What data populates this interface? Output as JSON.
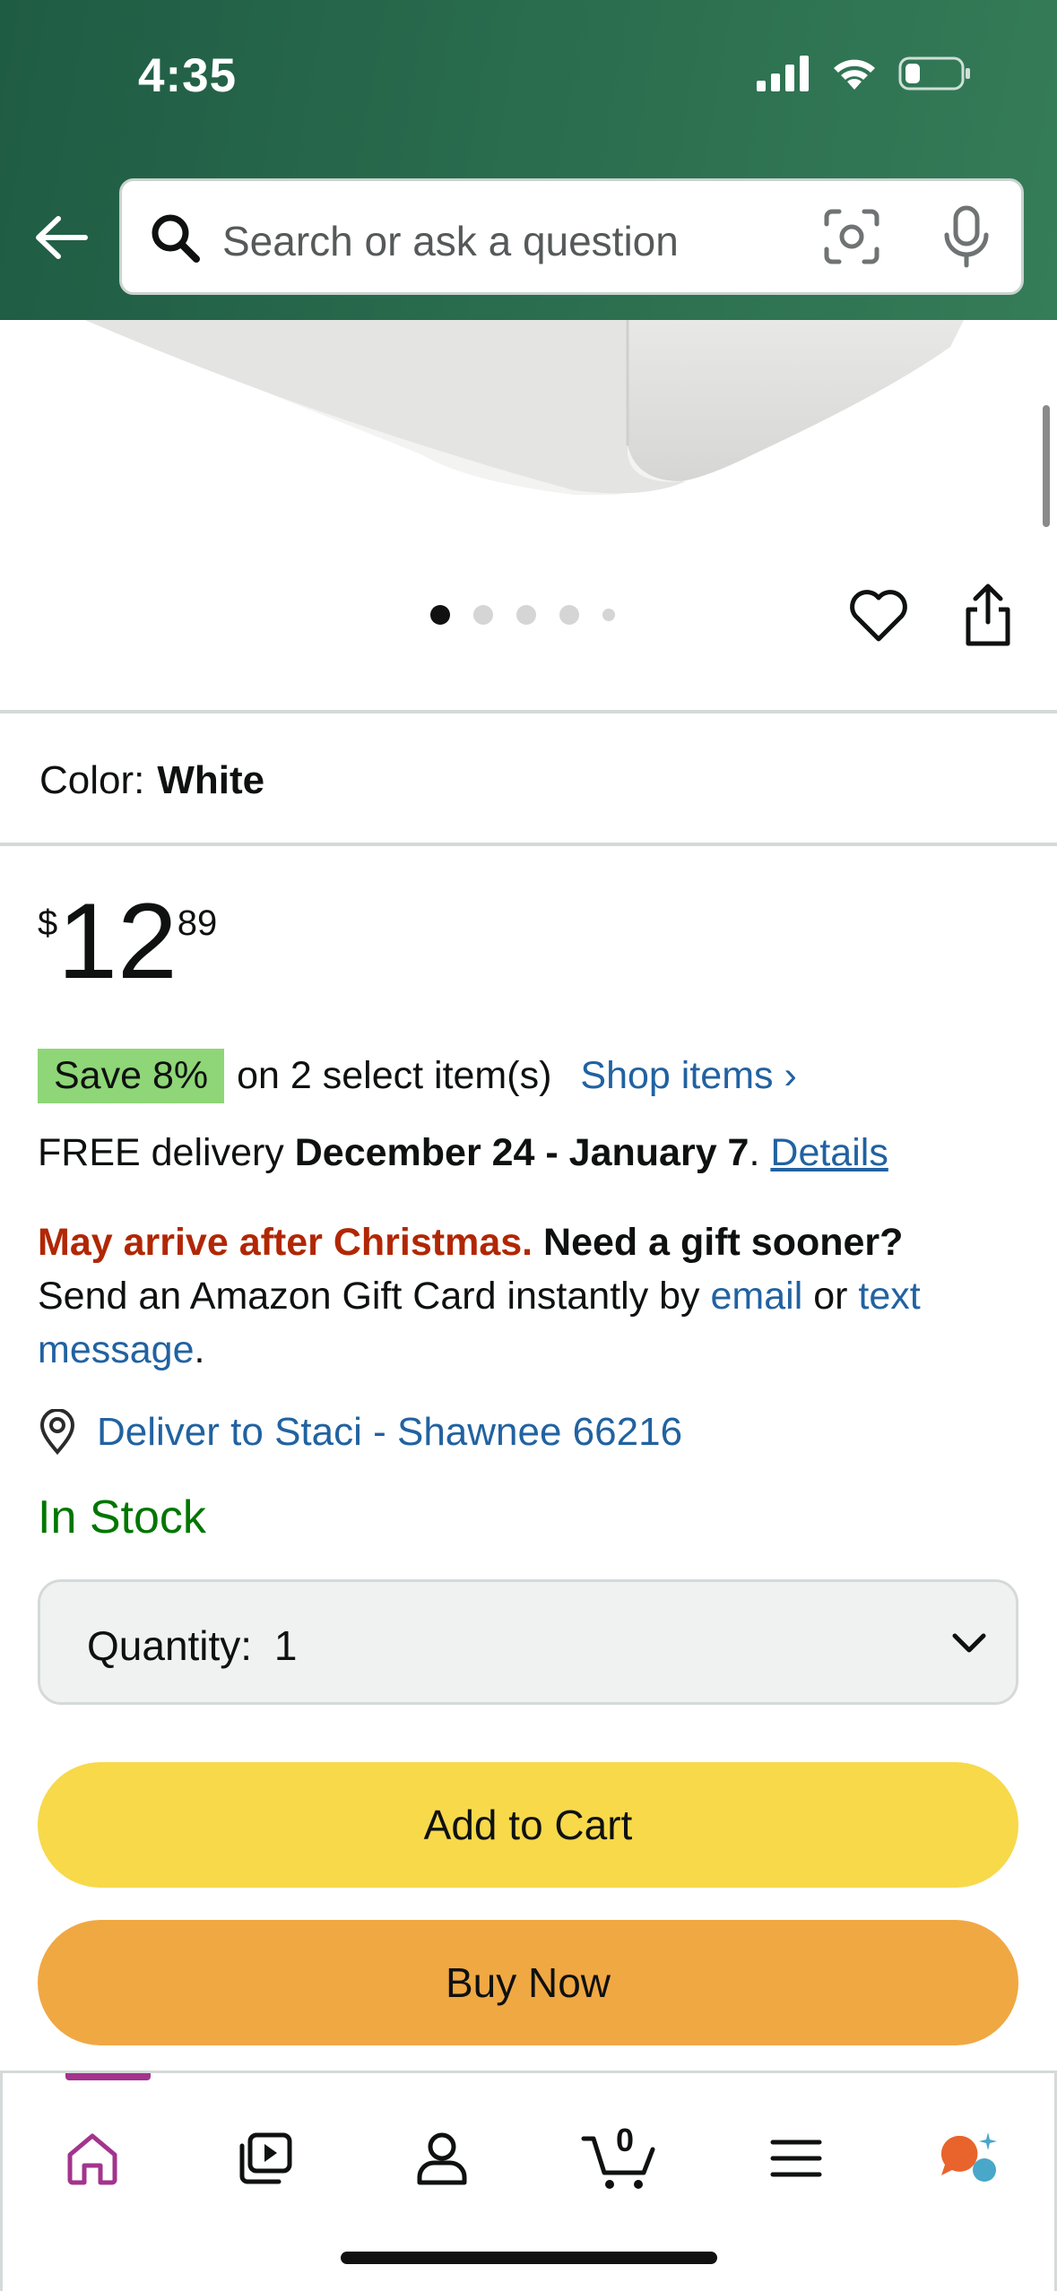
{
  "status_bar": {
    "time": "4:35"
  },
  "search": {
    "placeholder": "Search or ask a question"
  },
  "image_carousel": {
    "total_dots": 5,
    "active_index": 0
  },
  "product": {
    "color_label": "Color:",
    "color_value": "White",
    "price_symbol": "$",
    "price_whole": "12",
    "price_fraction": "89"
  },
  "promotion": {
    "save_badge": "Save 8%",
    "save_text": "on 2 select item(s)",
    "shop_link": "Shop items ›"
  },
  "delivery": {
    "prefix": "FREE delivery ",
    "dates": "December 24 - January 7",
    "separator": ". ",
    "details_link": "Details"
  },
  "gift_notice": {
    "warning": "May arrive after Christmas.",
    "question": "Need a gift sooner?",
    "send_text": "Send an Amazon Gift Card instantly by ",
    "email_link": "email",
    "or_text": " or ",
    "text_link": "text message",
    "end": "."
  },
  "location": {
    "deliver_to": "Deliver to Staci - Shawnee 66216"
  },
  "stock": {
    "status": "In Stock"
  },
  "quantity": {
    "label": "Quantity:",
    "value": "1"
  },
  "actions": {
    "add_to_cart": "Add to Cart",
    "buy_now": "Buy Now"
  },
  "bottom_nav": {
    "cart_count": "0",
    "items": [
      "home",
      "video",
      "account",
      "cart",
      "menu",
      "rufus"
    ]
  },
  "colors": {
    "header_green": "#2b6e4f",
    "link_blue": "#2162a1",
    "stock_green": "#007600",
    "warning_red": "#b12704",
    "save_badge_green": "#8ed677",
    "add_to_cart_yellow": "#f7d94a",
    "buy_now_orange": "#f0a843",
    "nav_active_magenta": "#a3348d"
  }
}
